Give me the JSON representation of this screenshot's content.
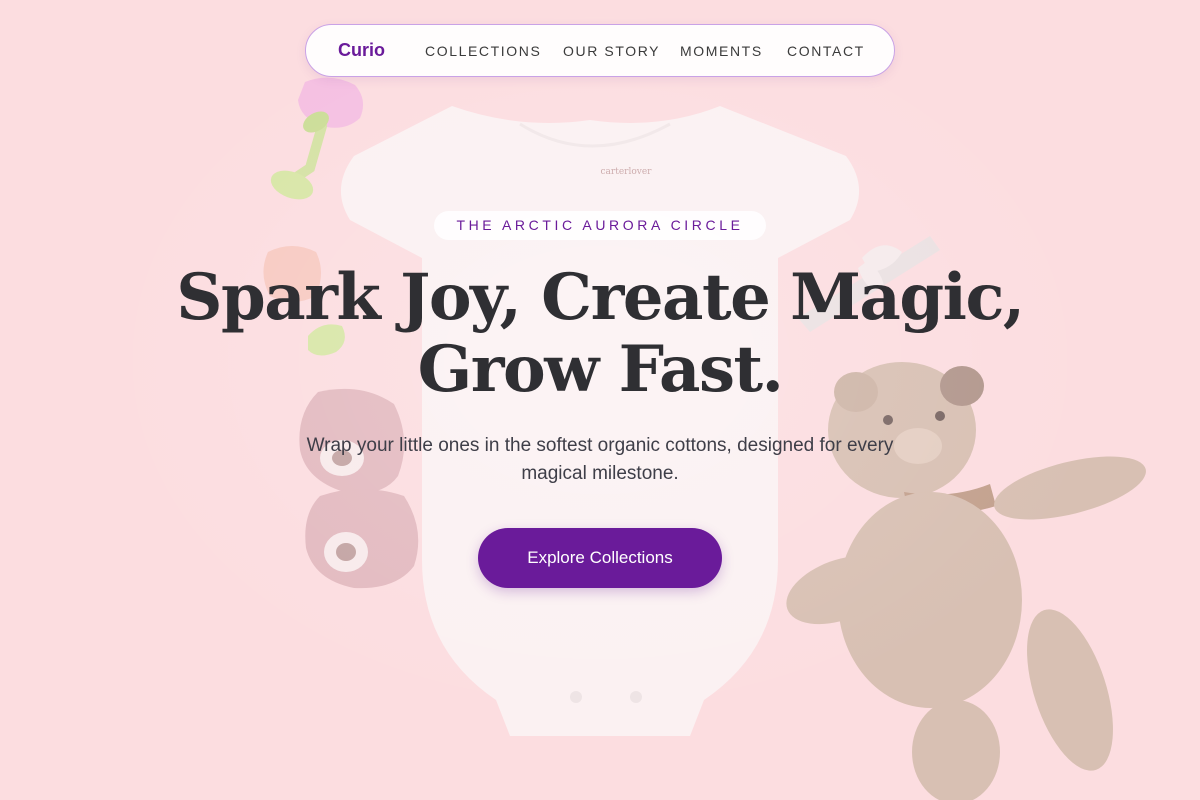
{
  "nav": {
    "brand": "Curio",
    "links": [
      "COLLECTIONS",
      "OUR STORY",
      "MOMENTS",
      "CONTACT"
    ]
  },
  "hero": {
    "eyebrow": "THE ARCTIC AURORA CIRCLE",
    "headline_line1": "Spark Joy, Create Magic,",
    "headline_line2": "Grow Fast.",
    "subtitle_line1": "Wrap your little ones in the softest organic cottons, designed for every",
    "subtitle_line2": "magical milestone.",
    "cta_label": "Explore Collections"
  },
  "background": {
    "onesie_label": "carterlover",
    "objects": [
      "onesie-illustration",
      "teddy-bear-illustration",
      "baby-shoes-illustration",
      "teether-toy-illustration",
      "hair-bow-illustration"
    ]
  },
  "colors": {
    "background": "#fcdde0",
    "accent": "#6a1b9a",
    "headline": "#2f2f33",
    "nav_border": "#c9a2e6"
  }
}
